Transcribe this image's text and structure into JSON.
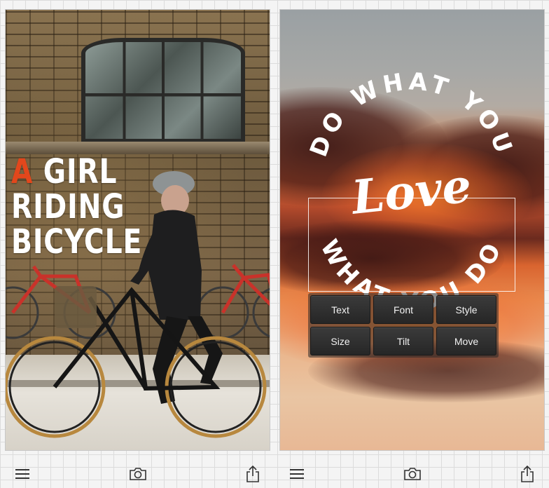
{
  "left_screen": {
    "headline": {
      "accent_word": "A",
      "line1_rest": " GIRL",
      "line2": "RIDING",
      "line3": "BICYCLE"
    },
    "accent_color": "#e2471c",
    "toolbar": {
      "menu_icon": "menu-icon",
      "camera_icon": "camera-icon",
      "share_icon": "share-icon"
    }
  },
  "right_screen": {
    "quote": {
      "arc_top": "DO WHAT YOU",
      "script_word": "Love",
      "arc_bottom": "WHAT YOU DO"
    },
    "edit_buttons": [
      {
        "label": "Text"
      },
      {
        "label": "Font"
      },
      {
        "label": "Style"
      },
      {
        "label": "Size"
      },
      {
        "label": "Tilt"
      },
      {
        "label": "Move"
      }
    ],
    "toolbar": {
      "menu_icon": "menu-icon",
      "camera_icon": "camera-icon",
      "share_icon": "share-icon"
    }
  }
}
